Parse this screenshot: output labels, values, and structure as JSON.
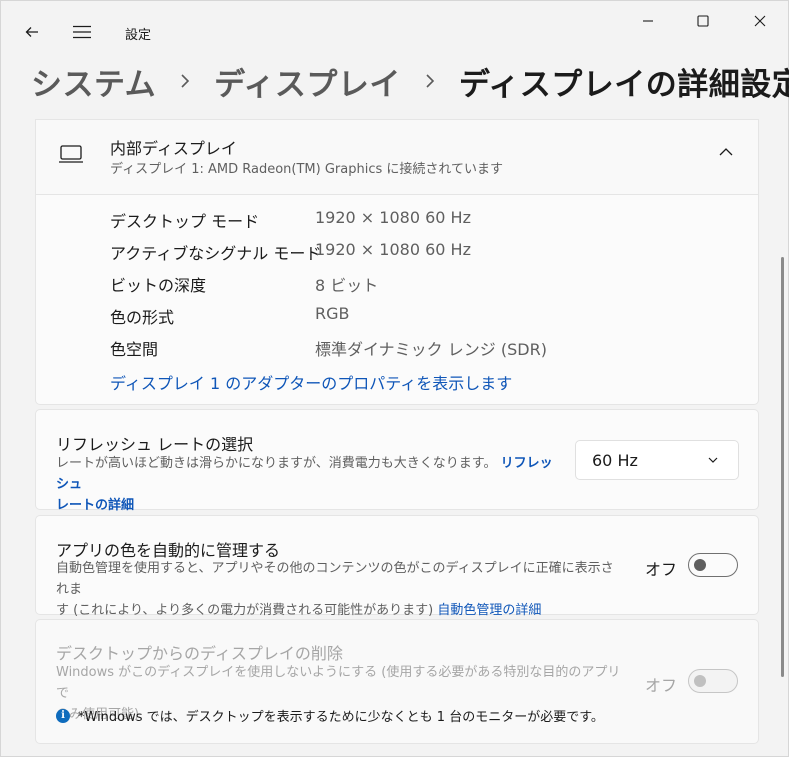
{
  "app": {
    "title": "設定"
  },
  "breadcrumb": {
    "items": [
      "システム",
      "ディスプレイ"
    ],
    "current": "ディスプレイの詳細設定"
  },
  "display": {
    "name": "内部ディスプレイ",
    "subtitle": "ディスプレイ 1: AMD Radeon(TM) Graphics に接続されています",
    "rows": [
      {
        "label": "デスクトップ モード",
        "value": "1920 × 1080 60 Hz"
      },
      {
        "label": "アクティブなシグナル モード",
        "value": "1920 × 1080 60 Hz"
      },
      {
        "label": "ビットの深度",
        "value": "8 ビット"
      },
      {
        "label": "色の形式",
        "value": "RGB"
      },
      {
        "label": "色空間",
        "value": "標準ダイナミック レンジ (SDR)"
      }
    ],
    "adapter_link": "ディスプレイ 1 のアダプターのプロパティを表示します"
  },
  "refresh": {
    "title": "リフレッシュ レートの選択",
    "desc": "レートが高いほど動きは滑らかになりますが、消費電力も大きくなります。",
    "link_part1": "リフレッシュ",
    "link_part2": "レートの詳細",
    "selected": "60 Hz"
  },
  "color_mgmt": {
    "title": "アプリの色を自動的に管理する",
    "desc_line1": "自動色管理を使用すると、アプリやその他のコンテンツの色がこのディスプレイに正確に表示されま",
    "desc_line2": "す (これにより、より多くの電力が消費される可能性があります)",
    "link": "自動色管理の詳細",
    "toggle_label": "オフ",
    "on": false
  },
  "remove_display": {
    "title": "デスクトップからのディスプレイの削除",
    "desc_line1": "Windows がこのディスプレイを使用しないようにする (使用する必要がある特別な目的のアプリで",
    "desc_line2": "のみ使用可能)",
    "toggle_label": "オフ",
    "on": false,
    "note": "*Windows では、デスクトップを表示するために少なくとも 1 台のモニターが必要です。"
  }
}
